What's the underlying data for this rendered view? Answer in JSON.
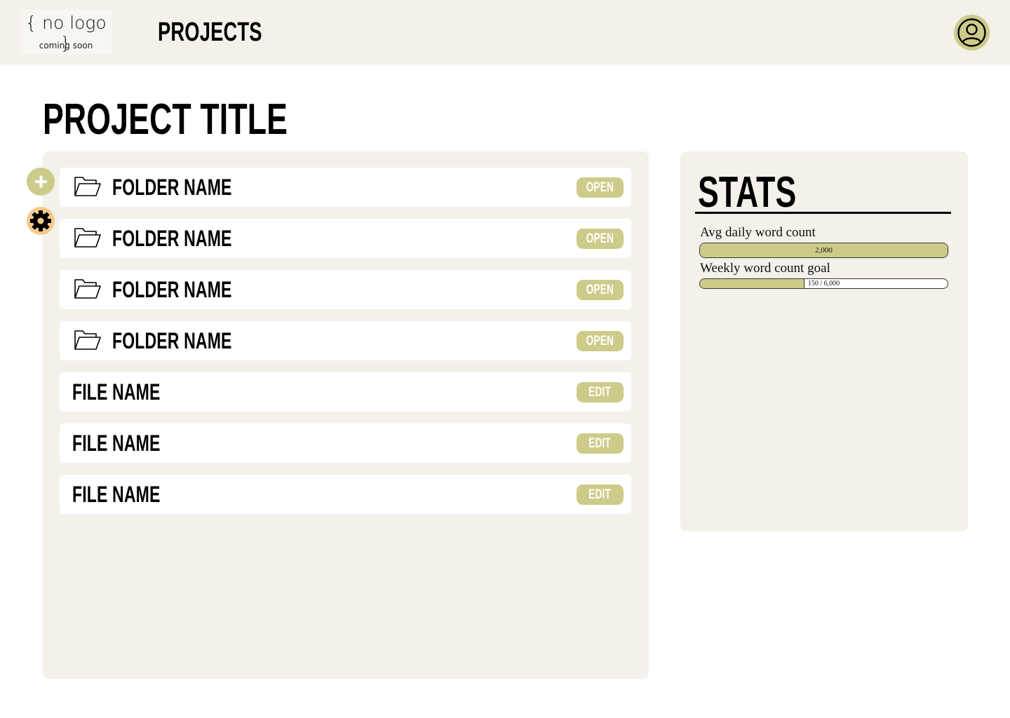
{
  "header": {
    "logo_main": "{ no logo }",
    "logo_sub": "coming soon",
    "nav_title": "PROJECTS",
    "profile_icon": "user-circle-icon"
  },
  "page": {
    "title": "PROJECT TITLE"
  },
  "sidebar_actions": {
    "add_icon": "plus-icon",
    "settings_icon": "gear-icon"
  },
  "items": [
    {
      "type": "folder",
      "name": "FOLDER NAME",
      "action": "OPEN"
    },
    {
      "type": "folder",
      "name": "FOLDER NAME",
      "action": "OPEN"
    },
    {
      "type": "folder",
      "name": "FOLDER NAME",
      "action": "OPEN"
    },
    {
      "type": "folder",
      "name": "FOLDER NAME",
      "action": "OPEN"
    },
    {
      "type": "file",
      "name": "FILE NAME",
      "action": "EDIT"
    },
    {
      "type": "file",
      "name": "FILE NAME",
      "action": "EDIT"
    },
    {
      "type": "file",
      "name": "FILE NAME",
      "action": "EDIT"
    }
  ],
  "stats": {
    "title": "STATS",
    "avg_daily": {
      "label": "Avg daily word count",
      "value_text": "2,000",
      "fill": 1.0
    },
    "weekly_goal": {
      "label": "Weekly word count goal",
      "value_text": "150 / 6,000",
      "fill": 0.42
    }
  },
  "colors": {
    "accent": "#cdcb89",
    "panel_bg": "#f3f1e9",
    "settings_accent": "#f5c98a"
  }
}
